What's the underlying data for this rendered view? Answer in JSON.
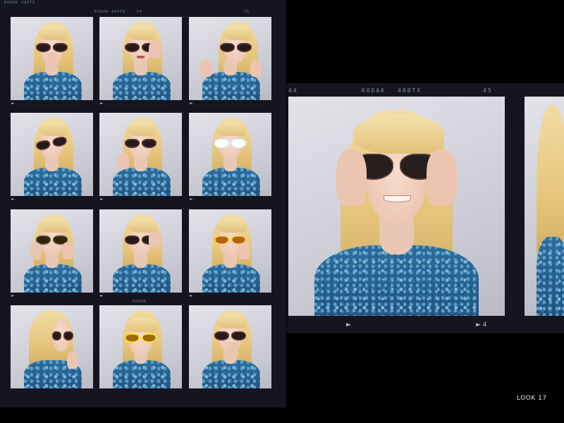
{
  "contact_sheet": {
    "top_edge_text": "KODAK 400TX",
    "rows": [
      {
        "edge": [
          "",
          "KODAK 400TX",
          "",
          "54",
          "",
          "55"
        ],
        "frames": [
          {
            "glasses": "tortoise",
            "pose": "hand-mouth"
          },
          {
            "glasses": "black",
            "pose": "hand-glasses"
          },
          {
            "glasses": "black",
            "pose": "fists"
          }
        ],
        "marks": [
          "►",
          "►",
          "►"
        ]
      },
      {
        "edge": [
          "",
          "",
          "",
          "",
          "",
          ""
        ],
        "frames": [
          {
            "glasses": "black",
            "pose": "tilt"
          },
          {
            "glasses": "black",
            "pose": "hand-cheek"
          },
          {
            "glasses": "white",
            "pose": "wink"
          }
        ],
        "marks": [
          "►",
          "►",
          "►"
        ]
      },
      {
        "edge": [
          "",
          "",
          "",
          "",
          "",
          ""
        ],
        "frames": [
          {
            "glasses": "tortoise",
            "pose": "hands-cheeks"
          },
          {
            "glasses": "black",
            "pose": "hand-glasses"
          },
          {
            "glasses": "amber",
            "pose": "hand-face"
          }
        ],
        "marks": [
          "►",
          "►",
          "►"
        ]
      },
      {
        "edge": [
          "",
          "",
          "",
          "KODAK",
          "",
          ""
        ],
        "frames": [
          {
            "glasses": "black",
            "pose": "profile"
          },
          {
            "glasses": "amber",
            "pose": "look-down"
          },
          {
            "glasses": "black",
            "pose": "hand-mouth"
          }
        ],
        "marks": [
          "",
          "",
          ""
        ]
      }
    ]
  },
  "strip": {
    "left_number": "44",
    "brand": "KODAK",
    "film": "400TX",
    "right_number": "45",
    "bottom_left_mark": "►",
    "bottom_right_mark": "► 4"
  },
  "look_label": "LOOK 17",
  "colors": {
    "film": "#14151f",
    "background": "#000000",
    "shirt": "#2b6d9e",
    "hair": "#ead08f"
  }
}
